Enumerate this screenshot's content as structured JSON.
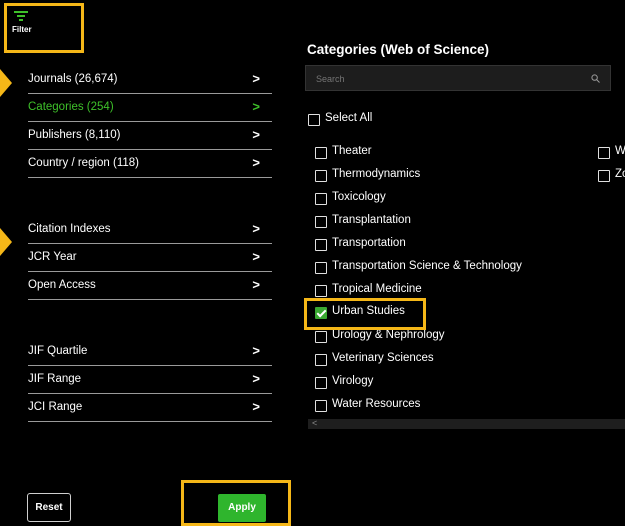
{
  "filter": {
    "label": "Filter",
    "icon": "filter-icon"
  },
  "sidebar": {
    "group1": [
      {
        "label": "Journals (26,674)",
        "active": false
      },
      {
        "label": "Categories (254)",
        "active": true
      },
      {
        "label": "Publishers (8,110)",
        "active": false
      },
      {
        "label": "Country / region (118)",
        "active": false
      }
    ],
    "group2": [
      {
        "label": "Citation Indexes"
      },
      {
        "label": "JCR Year"
      },
      {
        "label": "Open Access"
      }
    ],
    "group3": [
      {
        "label": "JIF Quartile"
      },
      {
        "label": "JIF Range"
      },
      {
        "label": "JCI Range"
      }
    ],
    "chevron": ">"
  },
  "main": {
    "title": "Categories (Web of Science)",
    "search": {
      "placeholder": "Search",
      "icon": "search-icon"
    },
    "select_all": "Select All",
    "categories": [
      {
        "label": "Theater",
        "checked": false
      },
      {
        "label": "Thermodynamics",
        "checked": false
      },
      {
        "label": "Toxicology",
        "checked": false
      },
      {
        "label": "Transplantation",
        "checked": false
      },
      {
        "label": "Transportation",
        "checked": false
      },
      {
        "label": "Transportation Science & Technology",
        "checked": false
      },
      {
        "label": "Tropical Medicine",
        "checked": false
      },
      {
        "label": "Urban Studies",
        "checked": true
      },
      {
        "label": "Urology & Nephrology",
        "checked": false
      },
      {
        "label": "Veterinary Sciences",
        "checked": false
      },
      {
        "label": "Virology",
        "checked": false
      },
      {
        "label": "Water Resources",
        "checked": false
      }
    ],
    "col2": [
      {
        "label": "W",
        "checked": false
      },
      {
        "label": "Zo",
        "checked": false
      }
    ],
    "scroll_left": "<"
  },
  "buttons": {
    "reset": "Reset",
    "apply": "Apply"
  },
  "colors": {
    "accent_green": "#3ec12a",
    "highlight": "#f5b718",
    "apply_bg": "#2fb52d"
  }
}
